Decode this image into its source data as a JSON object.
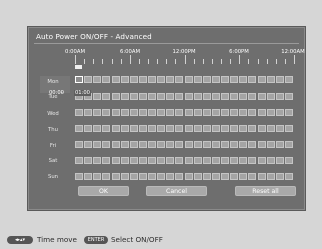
{
  "dialog": {
    "title": "Auto Power ON/OFF - Advanced",
    "time_labels": [
      "0:00AM",
      "6:00AM",
      "12:00PM",
      "6:00PM",
      "12:00AM"
    ],
    "days": [
      "Mon",
      "Tue",
      "Wed",
      "Thu",
      "Fri",
      "Sat",
      "Sun"
    ],
    "time_tip": {
      "from": "00:00",
      "separator": "-",
      "to": "01:00"
    },
    "buttons": {
      "ok": "OK",
      "cancel": "Cancel",
      "reset": "Reset all"
    }
  },
  "footer": {
    "arrows_key": "◂▸▴▾",
    "time_move": "Time move",
    "enter_key": "ENTER",
    "select": "Select ON/OFF"
  },
  "schedule": {
    "hours_per_day": 24,
    "selected": {
      "day": "Mon",
      "hour": 0
    }
  }
}
